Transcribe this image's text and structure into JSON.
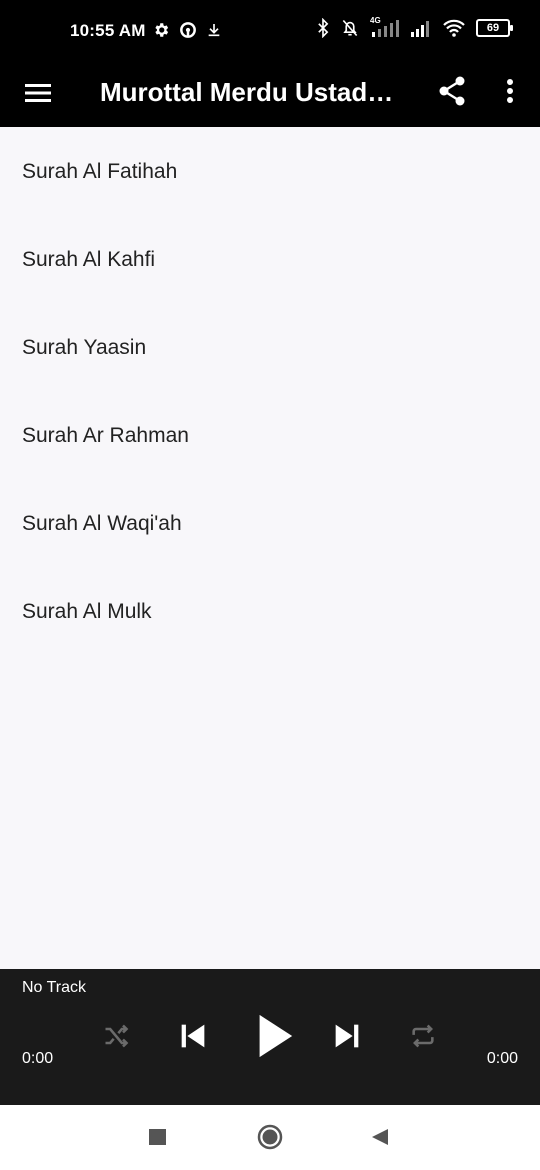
{
  "status_bar": {
    "time": "10:55 AM",
    "battery": "69",
    "network_label": "4G",
    "left_icons": [
      "gear-icon",
      "hotspot-icon",
      "download-icon"
    ],
    "right_icons": [
      "bluetooth-icon",
      "alarm-off-icon",
      "signal-icon",
      "signal-icon",
      "wifi-icon",
      "battery-icon"
    ]
  },
  "app_bar": {
    "title": "Murottal Merdu Ustadz Abdul Qodir",
    "menu_icon": "hamburger-menu-icon",
    "share_icon": "share-icon",
    "more_icon": "more-vert-icon"
  },
  "surah_list": [
    "Surah Al Fatihah",
    "Surah Al Kahfi",
    "Surah Yaasin",
    "Surah Ar Rahman",
    "Surah Al Waqi'ah",
    "Surah Al Mulk"
  ],
  "player": {
    "track": "No Track",
    "current_time": "0:00",
    "duration": "0:00",
    "controls": [
      "shuffle-icon",
      "skip-previous-icon",
      "play-icon",
      "skip-next-icon",
      "repeat-icon"
    ]
  },
  "nav_bar": {
    "buttons": [
      "recents-square-icon",
      "home-circle-icon",
      "back-triangle-icon"
    ]
  },
  "colors": {
    "bars": "#000000",
    "player_bg": "#1a1a1a",
    "list_bg": "#f8f7fa",
    "inactive_control": "#6b6b6b"
  }
}
